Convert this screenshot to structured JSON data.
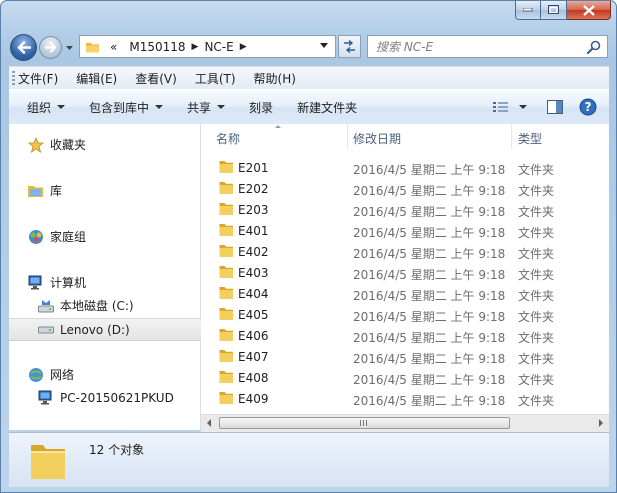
{
  "window": {
    "address": {
      "overflow": "«",
      "crumbs": [
        "M150118",
        "NC-E"
      ]
    },
    "search_placeholder": "搜索 NC-E"
  },
  "menu": [
    "文件(F)",
    "编辑(E)",
    "查看(V)",
    "工具(T)",
    "帮助(H)"
  ],
  "commands": {
    "organize": "组织",
    "include": "包含到库中",
    "share": "共享",
    "burn": "刻录",
    "new_folder": "新建文件夹"
  },
  "nav": {
    "favorites": "收藏夹",
    "libraries": "库",
    "homegroup": "家庭组",
    "computer": "计算机",
    "local_disk": "本地磁盘 (C:)",
    "lenovo": "Lenovo (D:)",
    "network": "网络",
    "pc": "PC-20150621PKUD"
  },
  "columns": {
    "name": "名称",
    "date": "修改日期",
    "type": "类型"
  },
  "files": [
    {
      "name": "E201",
      "date": "2016/4/5 星期二 上午 9:18",
      "type": "文件夹"
    },
    {
      "name": "E202",
      "date": "2016/4/5 星期二 上午 9:18",
      "type": "文件夹"
    },
    {
      "name": "E203",
      "date": "2016/4/5 星期二 上午 9:18",
      "type": "文件夹"
    },
    {
      "name": "E401",
      "date": "2016/4/5 星期二 上午 9:18",
      "type": "文件夹"
    },
    {
      "name": "E402",
      "date": "2016/4/5 星期二 上午 9:18",
      "type": "文件夹"
    },
    {
      "name": "E403",
      "date": "2016/4/5 星期二 上午 9:18",
      "type": "文件夹"
    },
    {
      "name": "E404",
      "date": "2016/4/5 星期二 上午 9:18",
      "type": "文件夹"
    },
    {
      "name": "E405",
      "date": "2016/4/5 星期二 上午 9:18",
      "type": "文件夹"
    },
    {
      "name": "E406",
      "date": "2016/4/5 星期二 上午 9:18",
      "type": "文件夹"
    },
    {
      "name": "E407",
      "date": "2016/4/5 星期二 上午 9:18",
      "type": "文件夹"
    },
    {
      "name": "E408",
      "date": "2016/4/5 星期二 上午 9:18",
      "type": "文件夹"
    },
    {
      "name": "E409",
      "date": "2016/4/5 星期二 上午 9:18",
      "type": "文件夹"
    }
  ],
  "status": {
    "count": "12 个对象"
  },
  "colors": {
    "folder": "#f2c94c",
    "frame": "#b4cfe8",
    "selected_nav": "#e4e4e4",
    "header_text": "#4c607a"
  },
  "icons": {
    "back": "back-arrow-icon",
    "forward": "forward-arrow-icon",
    "refresh": "refresh-icon",
    "search": "search-icon",
    "views": "views-icon",
    "preview": "preview-pane-icon",
    "help": "help-icon",
    "favorites": "star-icon",
    "libraries": "library-icon",
    "homegroup": "homegroup-icon",
    "computer": "computer-icon",
    "drive": "drive-icon",
    "network": "network-icon",
    "folder": "folder-icon"
  }
}
